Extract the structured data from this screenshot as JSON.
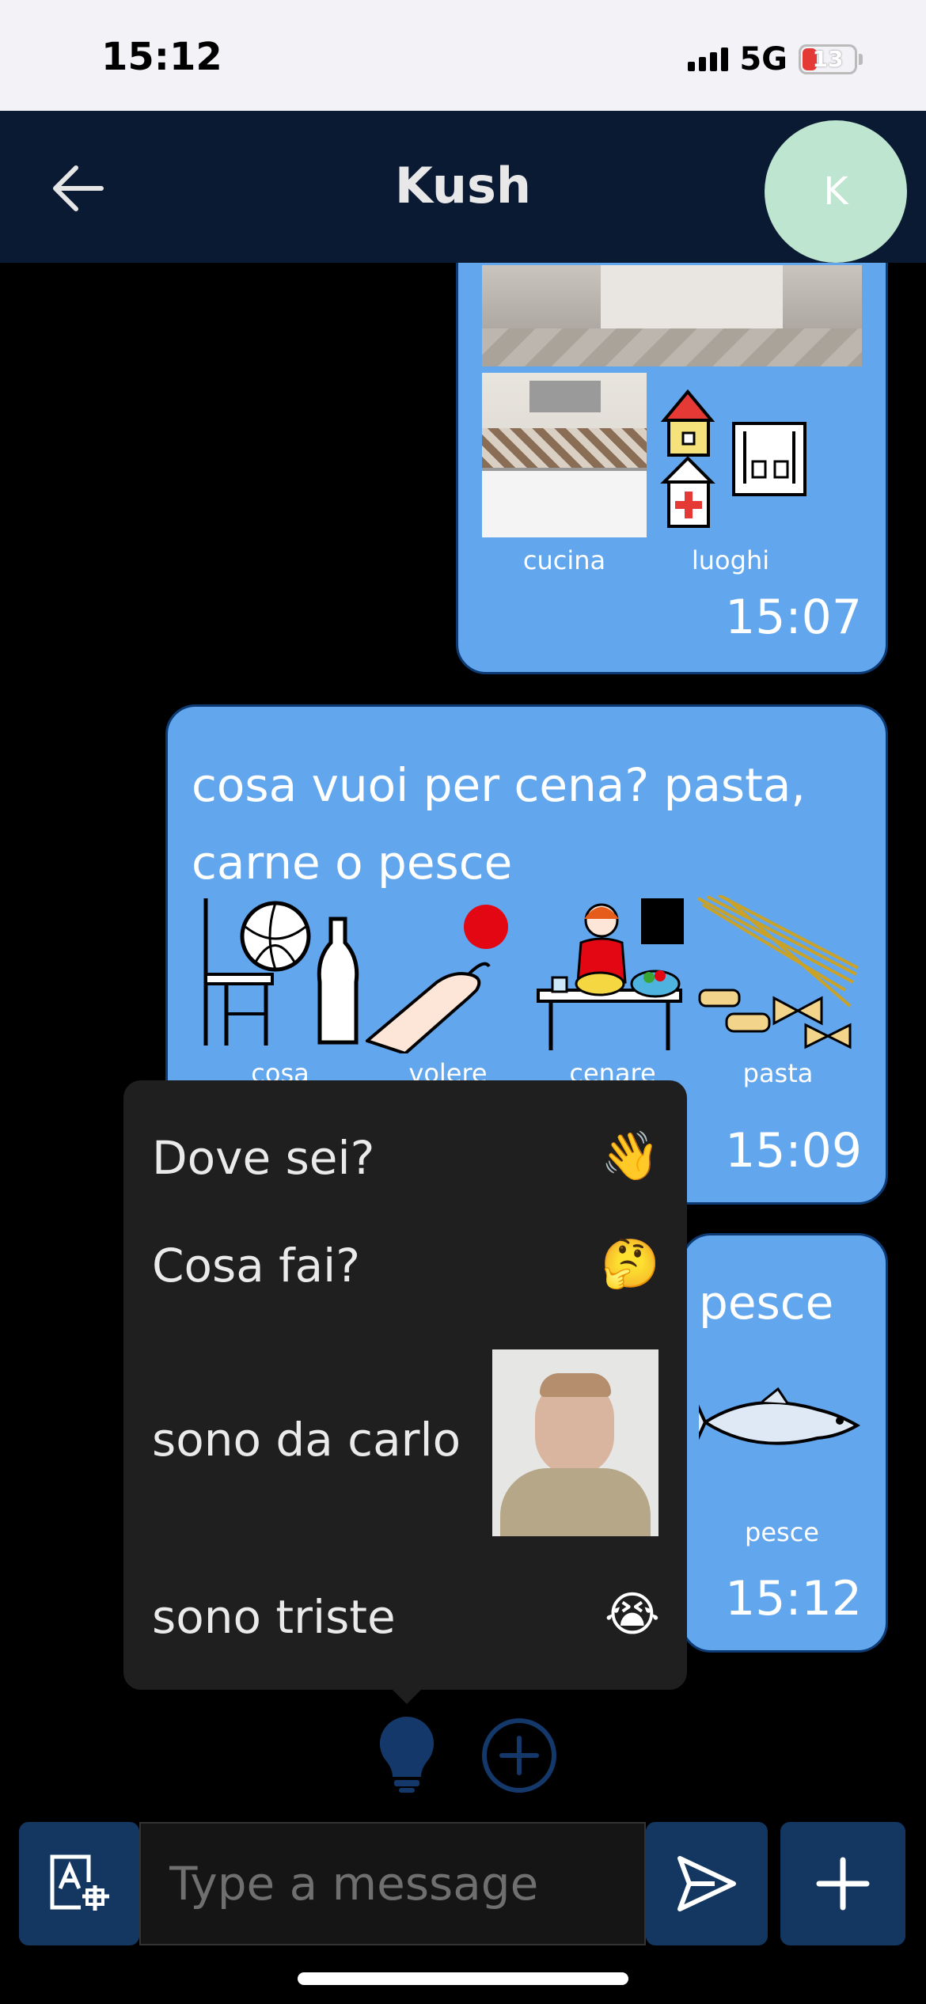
{
  "status": {
    "time": "15:12",
    "network": "5G",
    "battery": "13"
  },
  "header": {
    "title": "Kush",
    "avatar_initial": "K"
  },
  "messages": [
    {
      "symbols": [
        "cucina",
        "luoghi"
      ],
      "time": "15:07"
    },
    {
      "text_line1": "cosa vuoi per cena? pasta,",
      "text_line2": "carne o pesce",
      "symbols": [
        "cosa",
        "volere",
        "cenare",
        "pasta"
      ],
      "time": "15:09"
    },
    {
      "text": "pesce",
      "symbols": [
        "pesce"
      ],
      "time": "15:12"
    }
  ],
  "quick_replies": [
    {
      "label": "Dove sei?",
      "emoji": "👋"
    },
    {
      "label": "Cosa fai?",
      "emoji": "🤔"
    },
    {
      "label": "sono da carlo",
      "emoji": ""
    },
    {
      "label": "sono triste",
      "emoji": "😭"
    }
  ],
  "composer": {
    "placeholder": "Type a message"
  },
  "colors": {
    "header": "#0b1a33",
    "bubble": "#62a6ee",
    "accent": "#143762",
    "avatar": "#bde5cf"
  },
  "icons": [
    "back-arrow-icon",
    "lightbulb-icon",
    "plus-circle-icon",
    "symbol-keyboard-icon",
    "send-icon",
    "plus-icon"
  ]
}
